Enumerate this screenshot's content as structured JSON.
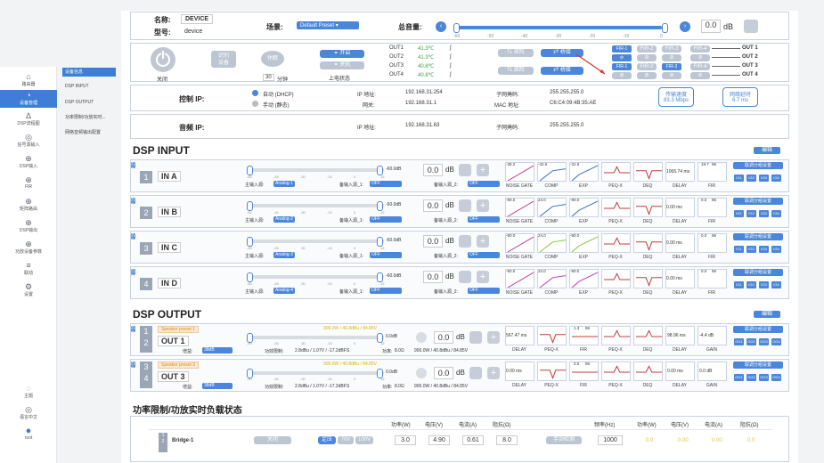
{
  "nav": {
    "items": [
      {
        "icon": "⌂",
        "label": "路由器"
      },
      {
        "icon": "◔",
        "label": "设备管理"
      },
      {
        "icon": "∆",
        "label": "DSP流程图"
      },
      {
        "icon": "◎",
        "label": "信号源输入"
      },
      {
        "icon": "⊕",
        "label": "DSP输入"
      },
      {
        "icon": "⊕",
        "label": "FIR"
      },
      {
        "icon": "⊕",
        "label": "矩阵路由"
      },
      {
        "icon": "⊕",
        "label": "DSP输出"
      },
      {
        "icon": "⊕",
        "label": "功放设备参数"
      },
      {
        "icon": "≡",
        "label": "联动"
      },
      {
        "icon": "⚙",
        "label": "设置"
      }
    ],
    "bottom": [
      {
        "icon": "◌",
        "label": "主题"
      },
      {
        "icon": "◎",
        "label": "语言中文"
      },
      {
        "icon": "●",
        "label": "root"
      }
    ]
  },
  "subnav": [
    "设备信息",
    "DSP INPUT",
    "DSP OUTPUT",
    "功率限制/功放实时...",
    "网络音频输出配置"
  ],
  "header": {
    "name_label": "名称:",
    "name": "DEVICE",
    "model_label": "型号:",
    "model": "device",
    "scene_label": "场景:",
    "scene": "Default Preset",
    "vol_label": "总音量:",
    "vol_value": "0.0",
    "vol_unit": "dB",
    "vol_ticks": [
      "-60",
      "-50",
      "-40",
      "-30",
      "-20",
      "-10",
      "0"
    ]
  },
  "power": {
    "off_label": "关闭",
    "recognize": "识别\n设备",
    "sleep": "休眠",
    "sleep_val": "30",
    "sleep_unit": "分钟",
    "on_btn": "开启",
    "off_btn": "关机",
    "state_label": "上电状态"
  },
  "temps": [
    {
      "name": "OUT1",
      "t": "41.3℃"
    },
    {
      "name": "OUT2",
      "t": "41.3℃"
    },
    {
      "name": "OUT3",
      "t": "40.8℃"
    },
    {
      "name": "OUT4",
      "t": "40.8℃"
    }
  ],
  "bridge": {
    "matrix": "矩阵",
    "bridge": "桥接",
    "fir": [
      "FIR-1",
      "FIR-2",
      "FIR-3",
      "FIR-4"
    ],
    "outs": [
      "OUT 1",
      "OUT 2",
      "OUT 3",
      "OUT 4"
    ]
  },
  "network": {
    "ctrl_label": "控制 IP:",
    "dhcp": "自动 (DHCP)",
    "static": "手动 (静态)",
    "ip_label": "IP 地址:",
    "ip": "192.168.31.254",
    "gw_label": "网关:",
    "gw": "192.168.31.1",
    "mask_label": "子网掩码:",
    "mask": "255.255.255.0",
    "mac_label": "MAC 地址:",
    "mac": "C6:C4:09:4B:35:AE",
    "rate_label": "传输速度",
    "rate": "83.3 Mbps",
    "lat_label": "网络延时",
    "lat": "6.7 ms",
    "audio_label": "音频 IP:",
    "audio_ip": "192.168.31.63",
    "audio_mask": "255.255.255.0"
  },
  "dsp_input": {
    "title": "DSP INPUT",
    "edit": "编辑",
    "main_src": "主输入源:",
    "bk1": "备输入源_1:",
    "bk2": "备输入源_2:",
    "off": "OFF",
    "link": "联调分组设置",
    "level": "-60.0dB",
    "ticks": [
      "-60",
      "-45",
      "-30",
      "-15",
      "0",
      "15"
    ],
    "channels": [
      {
        "n": "1",
        "name": "IN A",
        "src": "Analog-1",
        "gate": "-35.2",
        "comp": "-42.6",
        "exp": "-31.8",
        "delay": "1065.74 ms",
        "fir": "19.7",
        "fir2": "96"
      },
      {
        "n": "2",
        "name": "IN B",
        "src": "Analog-2",
        "gate": "-90.0",
        "comp": "24.0",
        "exp": "-90.0",
        "delay": "0.00 ms",
        "fir": "0.0",
        "fir2": "96"
      },
      {
        "n": "3",
        "name": "IN C",
        "src": "Analog-3",
        "gate": "-90.0",
        "comp": "24.0",
        "exp": "-90.0",
        "delay": "0.00 ms",
        "fir": "0.0",
        "fir2": "96"
      },
      {
        "n": "4",
        "name": "IN D",
        "src": "Analog-4",
        "gate": "-90.0",
        "comp": "24.0",
        "exp": "-90.0",
        "delay": "0.00 ms",
        "fir": "0.0",
        "fir2": "96"
      }
    ],
    "blocks": [
      "NOISE GATE",
      "COMP",
      "EXP",
      "PEQ-X",
      "DEQ",
      "DELAY",
      "FIR"
    ],
    "groups": [
      "IG1",
      "IG2",
      "IG3",
      "IG4"
    ]
  },
  "dsp_output": {
    "title": "DSP OUTPUT",
    "edit": "编辑",
    "gain_label": "增益:",
    "gain": "38dB",
    "power_info": "900.0W / 40.8dBu / 84.85V",
    "limit_label": "功效限制:",
    "limit": "2.8dBu / 1.07V / -17.2dBFS",
    "load_label": "功率:",
    "load": "8.0Ω",
    "load2": "900.0W / 40.8dBu / 84.85V",
    "level": "0.0dB",
    "ticks": [
      "-60",
      "-45",
      "-30",
      "-15",
      "0",
      "15"
    ],
    "channels": [
      {
        "n1": "1",
        "n2": "2",
        "preset": "Speaker preset 1",
        "name": "OUT 1",
        "delay1": "567.47 ms",
        "fir": "1.3",
        "fir2": "96",
        "delay2": "98.96 ms",
        "gain": "-4.4 dB"
      },
      {
        "n1": "3",
        "n2": "4",
        "preset": "Speaker preset 3",
        "name": "OUT 3",
        "delay1": "0.00 ms",
        "fir": "0.0",
        "fir2": "96",
        "delay2": "0.00 ms",
        "gain": "0.0 dB"
      }
    ],
    "blocks": [
      "DELAY",
      "PEQ-X",
      "FIR",
      "PEQ-X",
      "DEQ",
      "DELAY",
      "GAIN"
    ],
    "groups": [
      "OG1",
      "OG2",
      "OG3",
      "OG4"
    ]
  },
  "power_limit": {
    "title": "功率限制/功放实时负载状态",
    "cols1": [
      "功率(W)",
      "电压(V)",
      "电流(A)",
      "阻抗(Ω)"
    ],
    "cols2": [
      "频率(Hz)",
      "功率(W)",
      "电压(V)",
      "电流(A)",
      "阻抗(Ω)"
    ],
    "row": {
      "name": "Bridge-1",
      "close": "关闭",
      "fixed": "定压",
      "v70": "70V",
      "v100": "100V",
      "w": "3.0",
      "v": "4.90",
      "a": "0.61",
      "ohm": "8.0",
      "detect": "手动检测",
      "hz": "1000",
      "rw": "0.0",
      "rv": "0.00",
      "ra": "0.00",
      "rohm": "0.0"
    }
  },
  "colors": {
    "accent": "#4a86d9",
    "temp": "#3ba03b"
  }
}
